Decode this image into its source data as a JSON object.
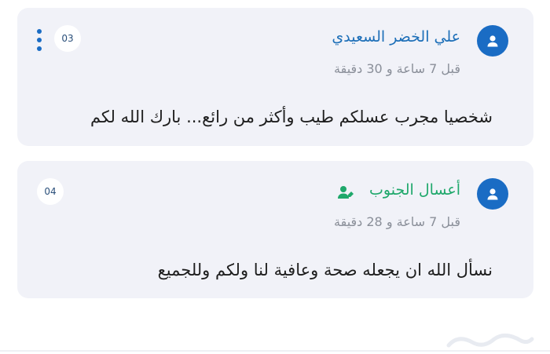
{
  "comments": [
    {
      "author": "علي الخضر السعيدي",
      "time": "قبل 7 ساعة و 30 دقيقة",
      "text": "شخصيا مجرب عسلكم طيب وأكثر من رائع... بارك الله لكم",
      "number": "03",
      "author_color": "#1d6fb8",
      "icons": [
        "user-avatar-icon",
        "more-vertical-icon"
      ]
    },
    {
      "author": "أعسال الجنوب",
      "time": "قبل 7 ساعة و 28 دقيقة",
      "text": "نسأل الله ان يجعله صحة وعافية لنا ولكم وللجميع",
      "number": "04",
      "author_color": "#1fa86b",
      "icons": [
        "user-avatar-icon",
        "verified-seller-icon"
      ]
    }
  ],
  "colors": {
    "card_bg": "#f1f2f8",
    "accent_blue": "#1a6cc4",
    "timestamp_gray": "#8a8f99"
  }
}
